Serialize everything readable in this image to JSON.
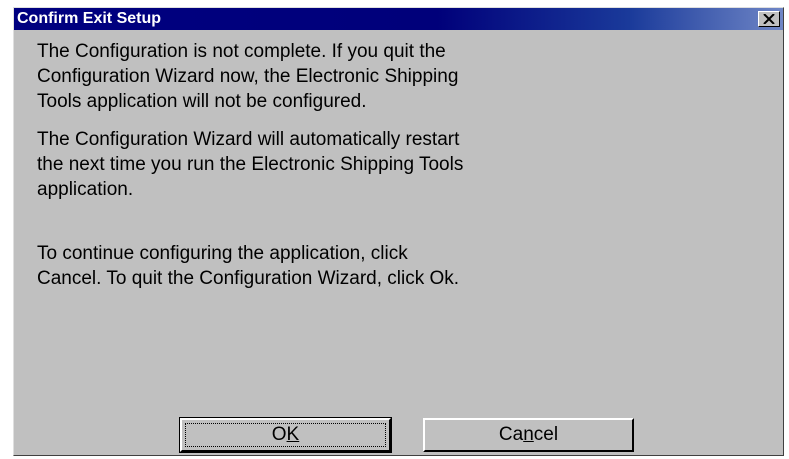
{
  "window": {
    "title": "Confirm Exit Setup",
    "close_icon": "close-icon"
  },
  "message": {
    "paragraph_1_lines": [
      "The Configuration is not complete.  If you quit the",
      "Configuration Wizard now, the Electronic Shipping",
      "Tools application will not be configured."
    ],
    "paragraph_2_lines": [
      "The Configuration Wizard will automatically restart",
      "the next time you run the Electronic Shipping Tools",
      "application."
    ],
    "paragraph_3_lines": [
      "To continue configuring the application, click",
      "Cancel.  To quit the Configuration Wizard, click Ok."
    ]
  },
  "buttons": {
    "ok": {
      "pre": "O",
      "accel": "K",
      "post": ""
    },
    "cancel": {
      "pre": "Ca",
      "accel": "n",
      "post": "cel"
    }
  },
  "colors": {
    "face": "#c0c0c0",
    "title_bar_start": "#000080",
    "title_bar_end": "#6f86c6",
    "title_text": "#ffffff"
  }
}
